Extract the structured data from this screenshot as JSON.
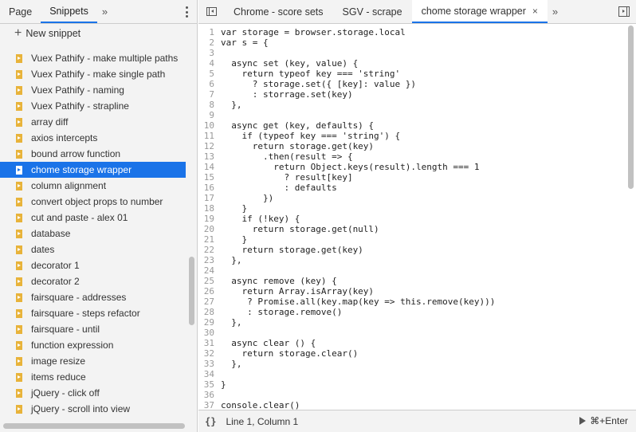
{
  "left_panel": {
    "tabs": [
      {
        "label": "Page",
        "active": false
      },
      {
        "label": "Snippets",
        "active": true
      }
    ],
    "overflow_glyph": "»",
    "new_snippet_label": "New snippet",
    "snippets": [
      {
        "label": "Vuex Pathify - make multiple paths"
      },
      {
        "label": "Vuex Pathify - make single path"
      },
      {
        "label": "Vuex Pathify - naming"
      },
      {
        "label": "Vuex Pathify - strapline"
      },
      {
        "label": "array diff"
      },
      {
        "label": "axios intercepts"
      },
      {
        "label": "bound arrow function"
      },
      {
        "label": "chome storage wrapper",
        "selected": true
      },
      {
        "label": "column alignment"
      },
      {
        "label": "convert object props to number"
      },
      {
        "label": "cut and paste - alex 01"
      },
      {
        "label": "database"
      },
      {
        "label": "dates"
      },
      {
        "label": "decorator 1"
      },
      {
        "label": "decorator 2"
      },
      {
        "label": "fairsquare - addresses"
      },
      {
        "label": "fairsquare - steps refactor"
      },
      {
        "label": "fairsquare - until"
      },
      {
        "label": "function expression"
      },
      {
        "label": "image resize"
      },
      {
        "label": "items reduce"
      },
      {
        "label": "jQuery - click off"
      },
      {
        "label": "jQuery - scroll into view"
      }
    ]
  },
  "editor": {
    "tabs": [
      {
        "label": "Chrome - score sets",
        "active": false
      },
      {
        "label": "SGV - scrape",
        "active": false
      },
      {
        "label": "chome storage wrapper",
        "active": true
      }
    ],
    "overflow_glyph": "»",
    "close_glyph": "×",
    "code_lines": [
      {
        "num": "1",
        "text": "var storage = browser.storage.local"
      },
      {
        "num": "2",
        "text": "var s = {"
      },
      {
        "num": "3",
        "text": ""
      },
      {
        "num": "4",
        "text": "  async set (key, value) {"
      },
      {
        "num": "5",
        "text": "    return typeof key === 'string'"
      },
      {
        "num": "6",
        "text": "      ? storage.set({ [key]: value })"
      },
      {
        "num": "7",
        "text": "      : storrage.set(key)"
      },
      {
        "num": "8",
        "text": "  },"
      },
      {
        "num": "9",
        "text": ""
      },
      {
        "num": "10",
        "text": "  async get (key, defaults) {"
      },
      {
        "num": "11",
        "text": "    if (typeof key === 'string') {"
      },
      {
        "num": "12",
        "text": "      return storage.get(key)"
      },
      {
        "num": "13",
        "text": "        .then(result => {"
      },
      {
        "num": "14",
        "text": "          return Object.keys(result).length === 1"
      },
      {
        "num": "15",
        "text": "            ? result[key]"
      },
      {
        "num": "16",
        "text": "            : defaults"
      },
      {
        "num": "17",
        "text": "        })"
      },
      {
        "num": "18",
        "text": "    }"
      },
      {
        "num": "19",
        "text": "    if (!key) {"
      },
      {
        "num": "20",
        "text": "      return storage.get(null)"
      },
      {
        "num": "21",
        "text": "    }"
      },
      {
        "num": "22",
        "text": "    return storage.get(key)"
      },
      {
        "num": "23",
        "text": "  },"
      },
      {
        "num": "24",
        "text": ""
      },
      {
        "num": "25",
        "text": "  async remove (key) {"
      },
      {
        "num": "26",
        "text": "    return Array.isArray(key)"
      },
      {
        "num": "27",
        "text": "     ? Promise.all(key.map(key => this.remove(key)))"
      },
      {
        "num": "28",
        "text": "     : storage.remove()"
      },
      {
        "num": "29",
        "text": "  },"
      },
      {
        "num": "30",
        "text": ""
      },
      {
        "num": "31",
        "text": "  async clear () {"
      },
      {
        "num": "32",
        "text": "    return storage.clear()"
      },
      {
        "num": "33",
        "text": "  },"
      },
      {
        "num": "34",
        "text": ""
      },
      {
        "num": "35",
        "text": "}"
      },
      {
        "num": "36",
        "text": ""
      },
      {
        "num": "37",
        "text": "console.clear()"
      }
    ],
    "status": {
      "format_glyph": "{}",
      "position": "Line 1, Column 1",
      "run_shortcut": "⌘+Enter"
    }
  }
}
